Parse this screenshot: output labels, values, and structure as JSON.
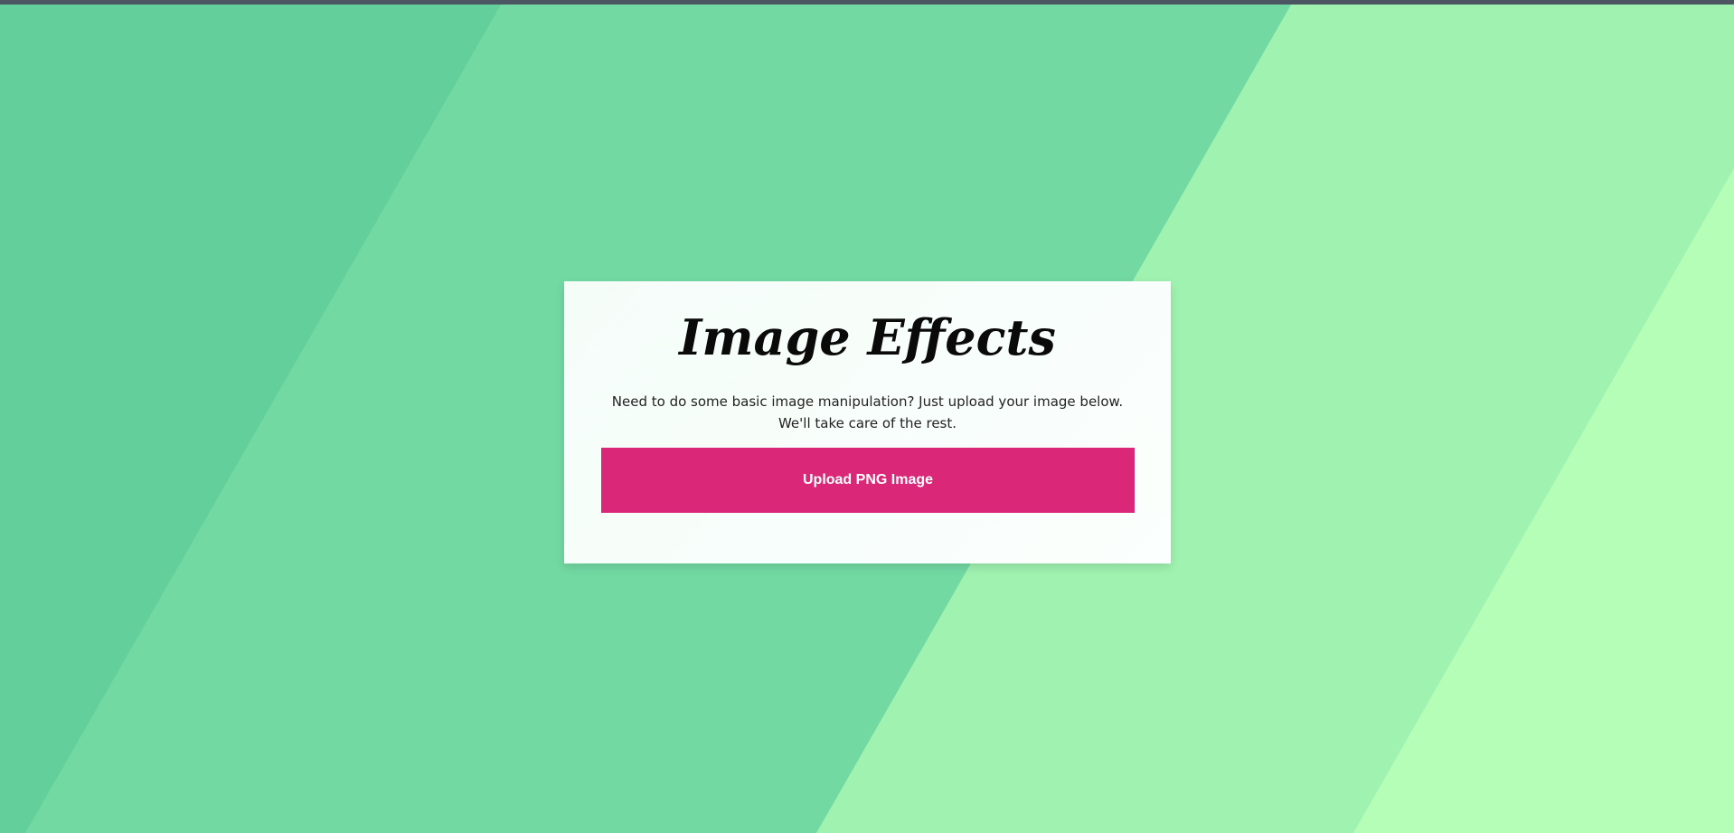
{
  "header": {
    "title": "Image Effects"
  },
  "main": {
    "description": "Need to do some basic image manipulation? Just upload your image below. We'll take care of the rest.",
    "upload_button_label": "Upload PNG Image"
  },
  "colors": {
    "background_band_1": "#63cf9b",
    "background_band_2": "#72d9a3",
    "background_band_3": "#9ff2b0",
    "background_band_4": "#b5feb7",
    "accent_button": "#db2777",
    "top_bar": "#4c5663"
  }
}
